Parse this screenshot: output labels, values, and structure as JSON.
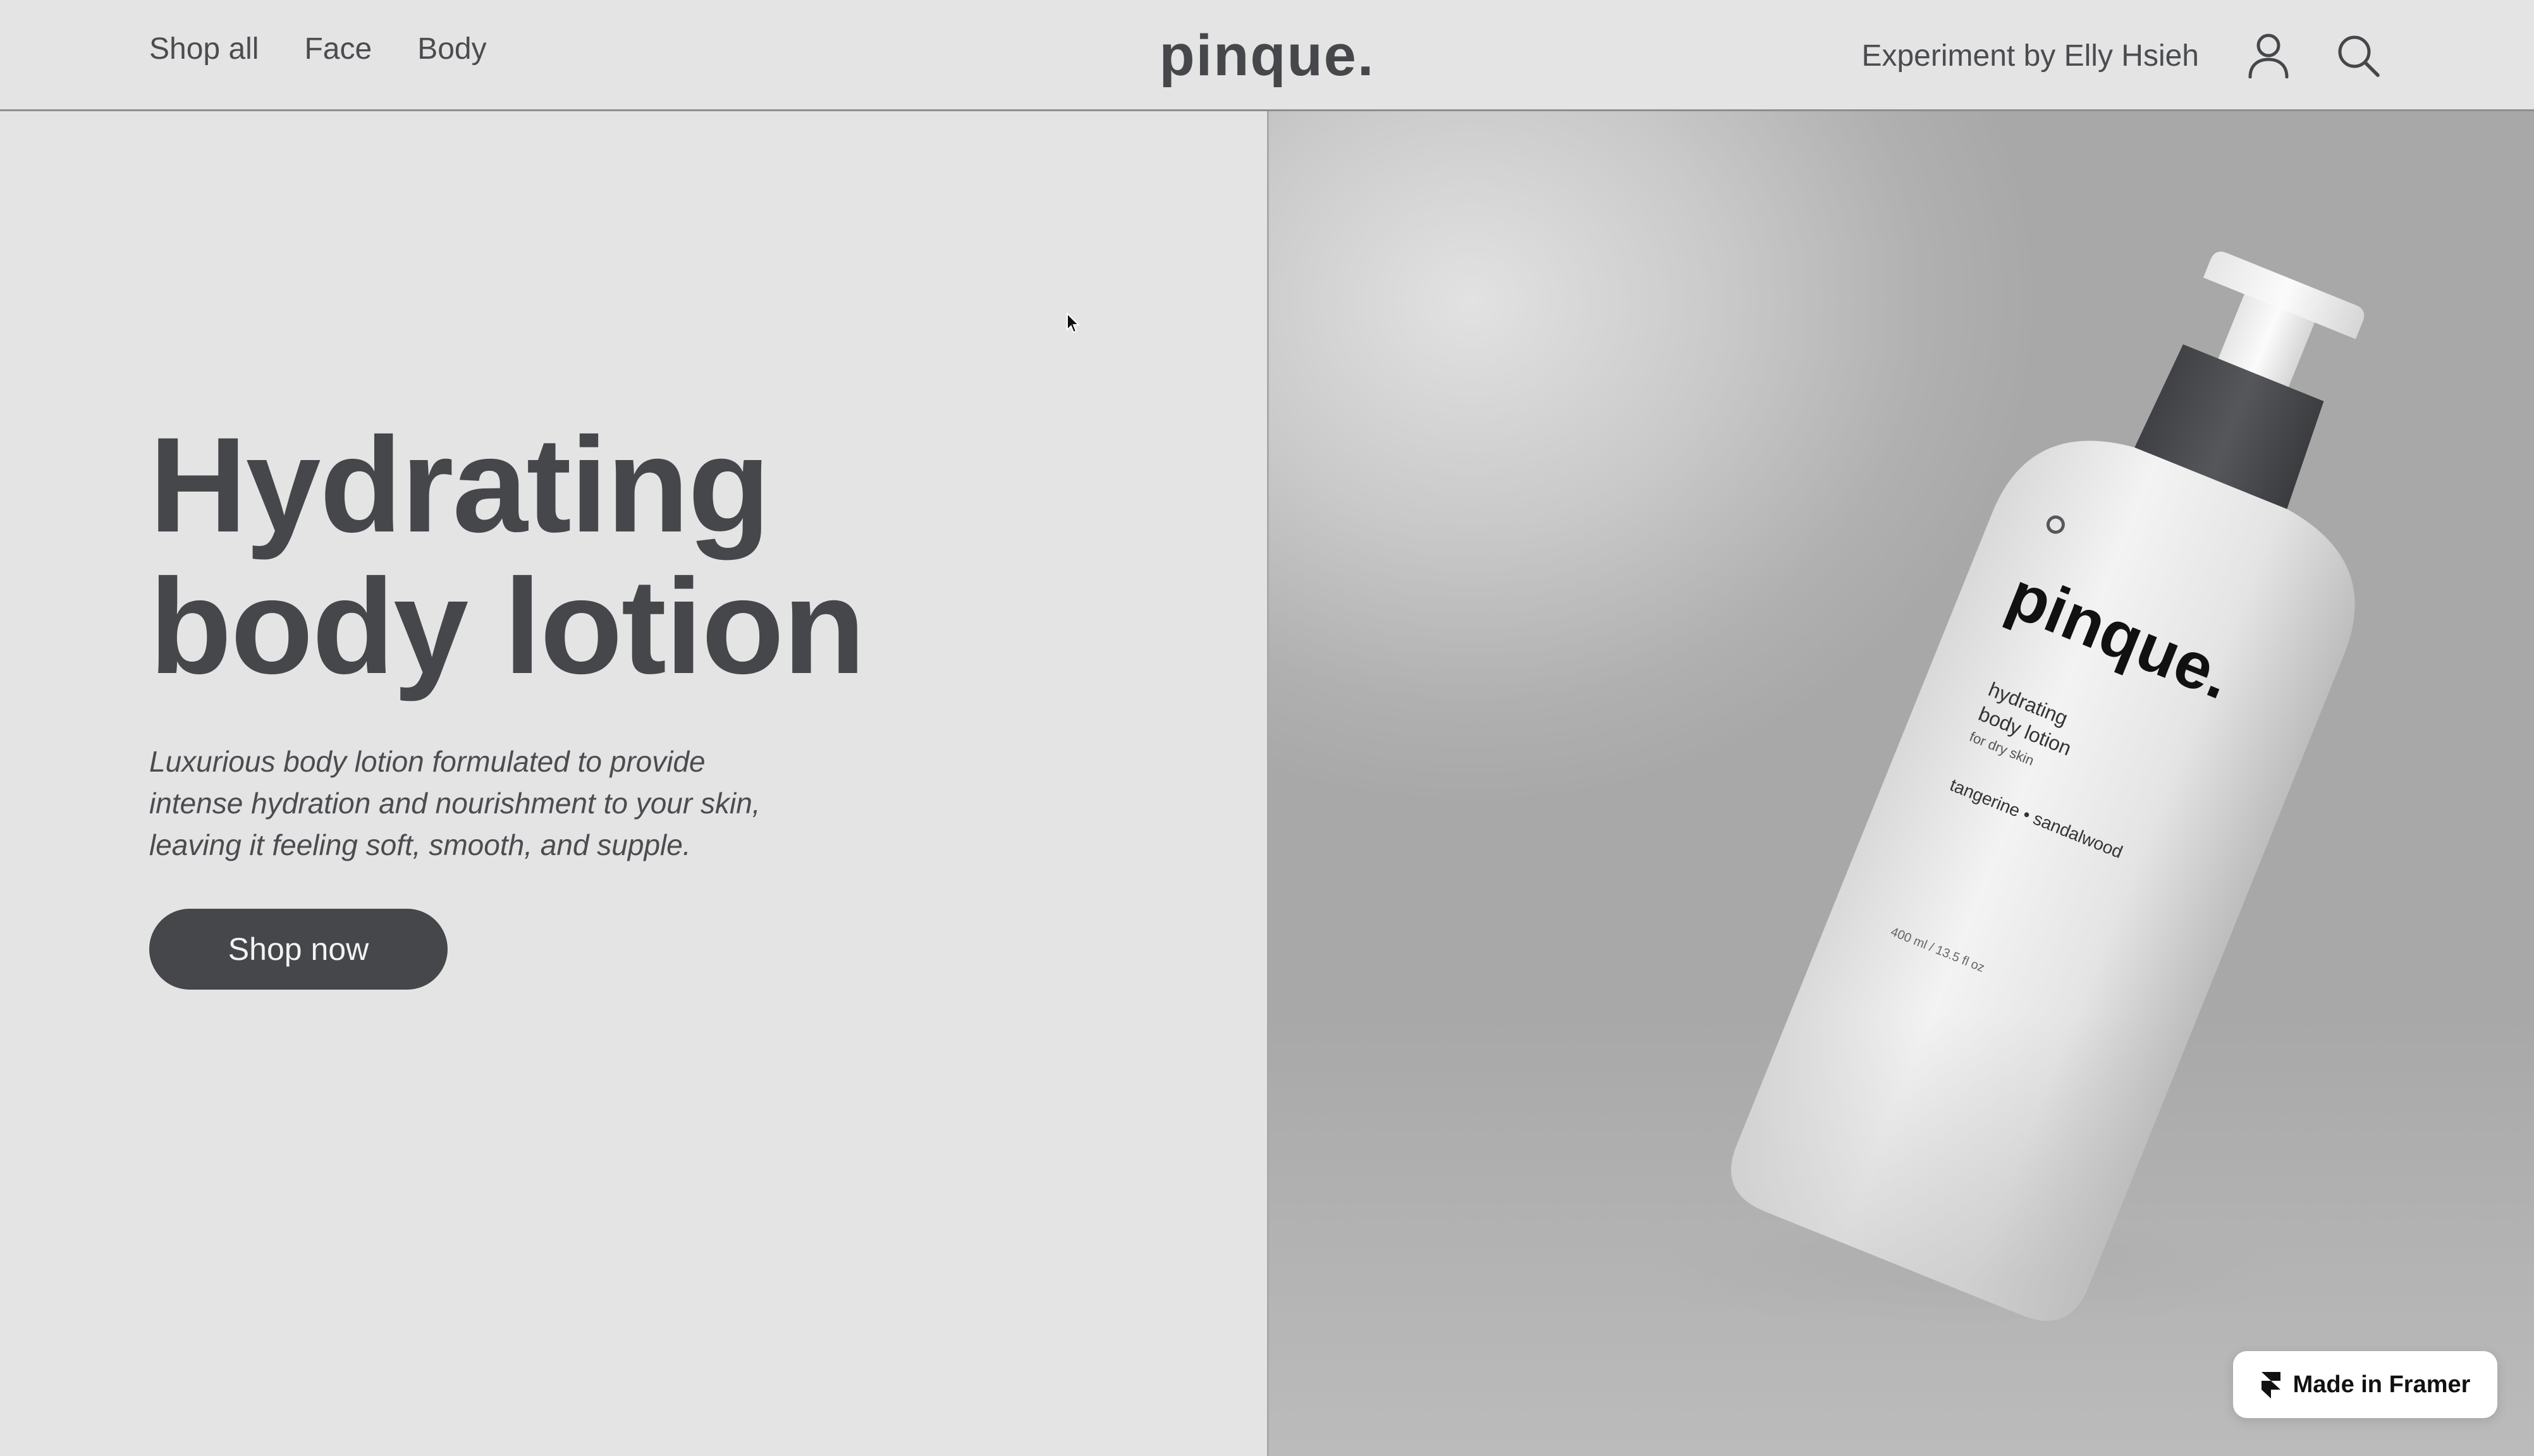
{
  "nav": {
    "links": [
      "Shop all",
      "Face",
      "Body"
    ]
  },
  "brand": {
    "name": "pinque."
  },
  "header_right": {
    "credit": "Experiment by Elly Hsieh",
    "icons": [
      "user-icon",
      "search-icon"
    ]
  },
  "hero": {
    "title_line1": "Hydrating",
    "title_line2": "body lotion",
    "description": "Luxurious body lotion formulated to provide intense hydration and nourishment to your skin, leaving it feeling soft, smooth, and supple.",
    "cta_label": "Shop now"
  },
  "product_label": {
    "brand": "pinque.",
    "line1": "hydrating",
    "line2": "body lotion",
    "line3": "for dry skin",
    "scent": "tangerine • sandalwood",
    "volume": "400 ml / 13.5 fl oz"
  },
  "badge": {
    "label": "Made in Framer"
  },
  "colors": {
    "background": "#e4e4e4",
    "text": "#45474b",
    "button": "#45474b",
    "button_text": "#f3f3f3"
  }
}
